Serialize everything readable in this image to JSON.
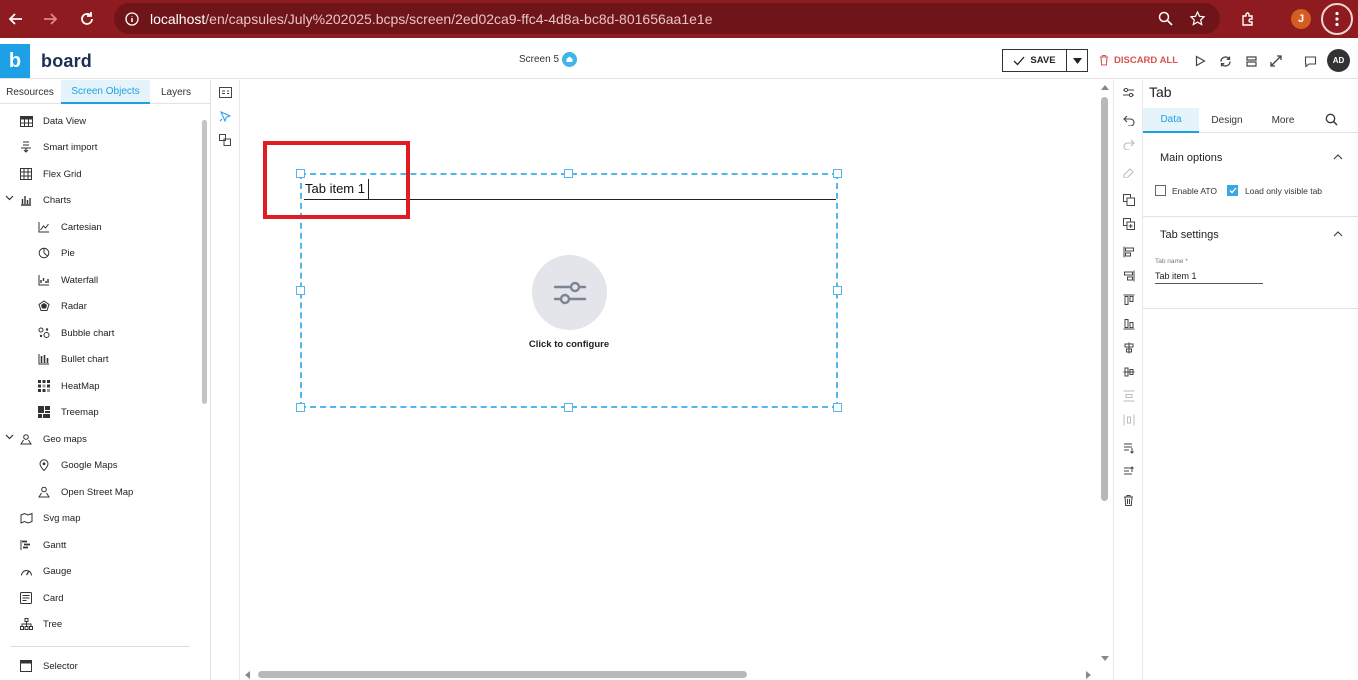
{
  "browser": {
    "url_host": "localhost",
    "url_path": "/en/capsules/July%202025.bcps/screen/2ed02ca9-ffc4-4d8a-bc8d-801656aa1e1e",
    "profile_initial": "J",
    "theme_color": "#8e1b1f"
  },
  "header": {
    "logo_letter": "b",
    "logo_text": "board",
    "screen_name": "Screen 5",
    "save_label": "SAVE",
    "discard_label": "DISCARD ALL",
    "user_initials": "AD",
    "accent": "#1ea0e6",
    "danger": "#d9534f"
  },
  "left_panel": {
    "tabs": [
      {
        "label": "Resources",
        "active": false
      },
      {
        "label": "Screen Objects",
        "active": true
      },
      {
        "label": "Layers",
        "active": false
      }
    ],
    "items": [
      {
        "label": "Data View",
        "icon": "table-icon"
      },
      {
        "label": "Smart import",
        "icon": "import-icon"
      },
      {
        "label": "Flex Grid",
        "icon": "grid-icon"
      },
      {
        "label": "Charts",
        "icon": "chart-icon",
        "expanded": true
      },
      {
        "label": "Cartesian",
        "icon": "line-chart-icon"
      },
      {
        "label": "Pie",
        "icon": "pie-icon"
      },
      {
        "label": "Waterfall",
        "icon": "waterfall-icon"
      },
      {
        "label": "Radar",
        "icon": "radar-icon"
      },
      {
        "label": "Bubble chart",
        "icon": "bubble-icon"
      },
      {
        "label": "Bullet chart",
        "icon": "bullet-icon"
      },
      {
        "label": "HeatMap",
        "icon": "heatmap-icon"
      },
      {
        "label": "Treemap",
        "icon": "treemap-icon"
      },
      {
        "label": "Geo maps",
        "icon": "map-pin-icon",
        "expanded": true
      },
      {
        "label": "Google Maps",
        "icon": "pin-icon"
      },
      {
        "label": "Open Street Map",
        "icon": "pin-person-icon"
      },
      {
        "label": "Svg map",
        "icon": "svg-map-icon"
      },
      {
        "label": "Gantt",
        "icon": "gantt-icon"
      },
      {
        "label": "Gauge",
        "icon": "gauge-icon"
      },
      {
        "label": "Card",
        "icon": "card-icon"
      },
      {
        "label": "Tree",
        "icon": "tree-icon"
      },
      {
        "label": "Selector",
        "icon": "selector-icon"
      }
    ]
  },
  "canvas": {
    "tab_item_label": "Tab item 1",
    "config_label": "Click to configure",
    "highlight_color": "#e01b22"
  },
  "props": {
    "title": "Tab",
    "tabs": [
      {
        "label": "Data",
        "active": true
      },
      {
        "label": "Design",
        "active": false
      },
      {
        "label": "More",
        "active": false
      }
    ],
    "main_options": {
      "title": "Main options",
      "enable_ato_label": "Enable ATO",
      "enable_ato_checked": false,
      "load_visible_label": "Load only visible tab",
      "load_visible_checked": true
    },
    "tab_settings": {
      "title": "Tab settings",
      "tab_name_label": "Tab name *",
      "tab_name_value": "Tab item 1"
    }
  }
}
